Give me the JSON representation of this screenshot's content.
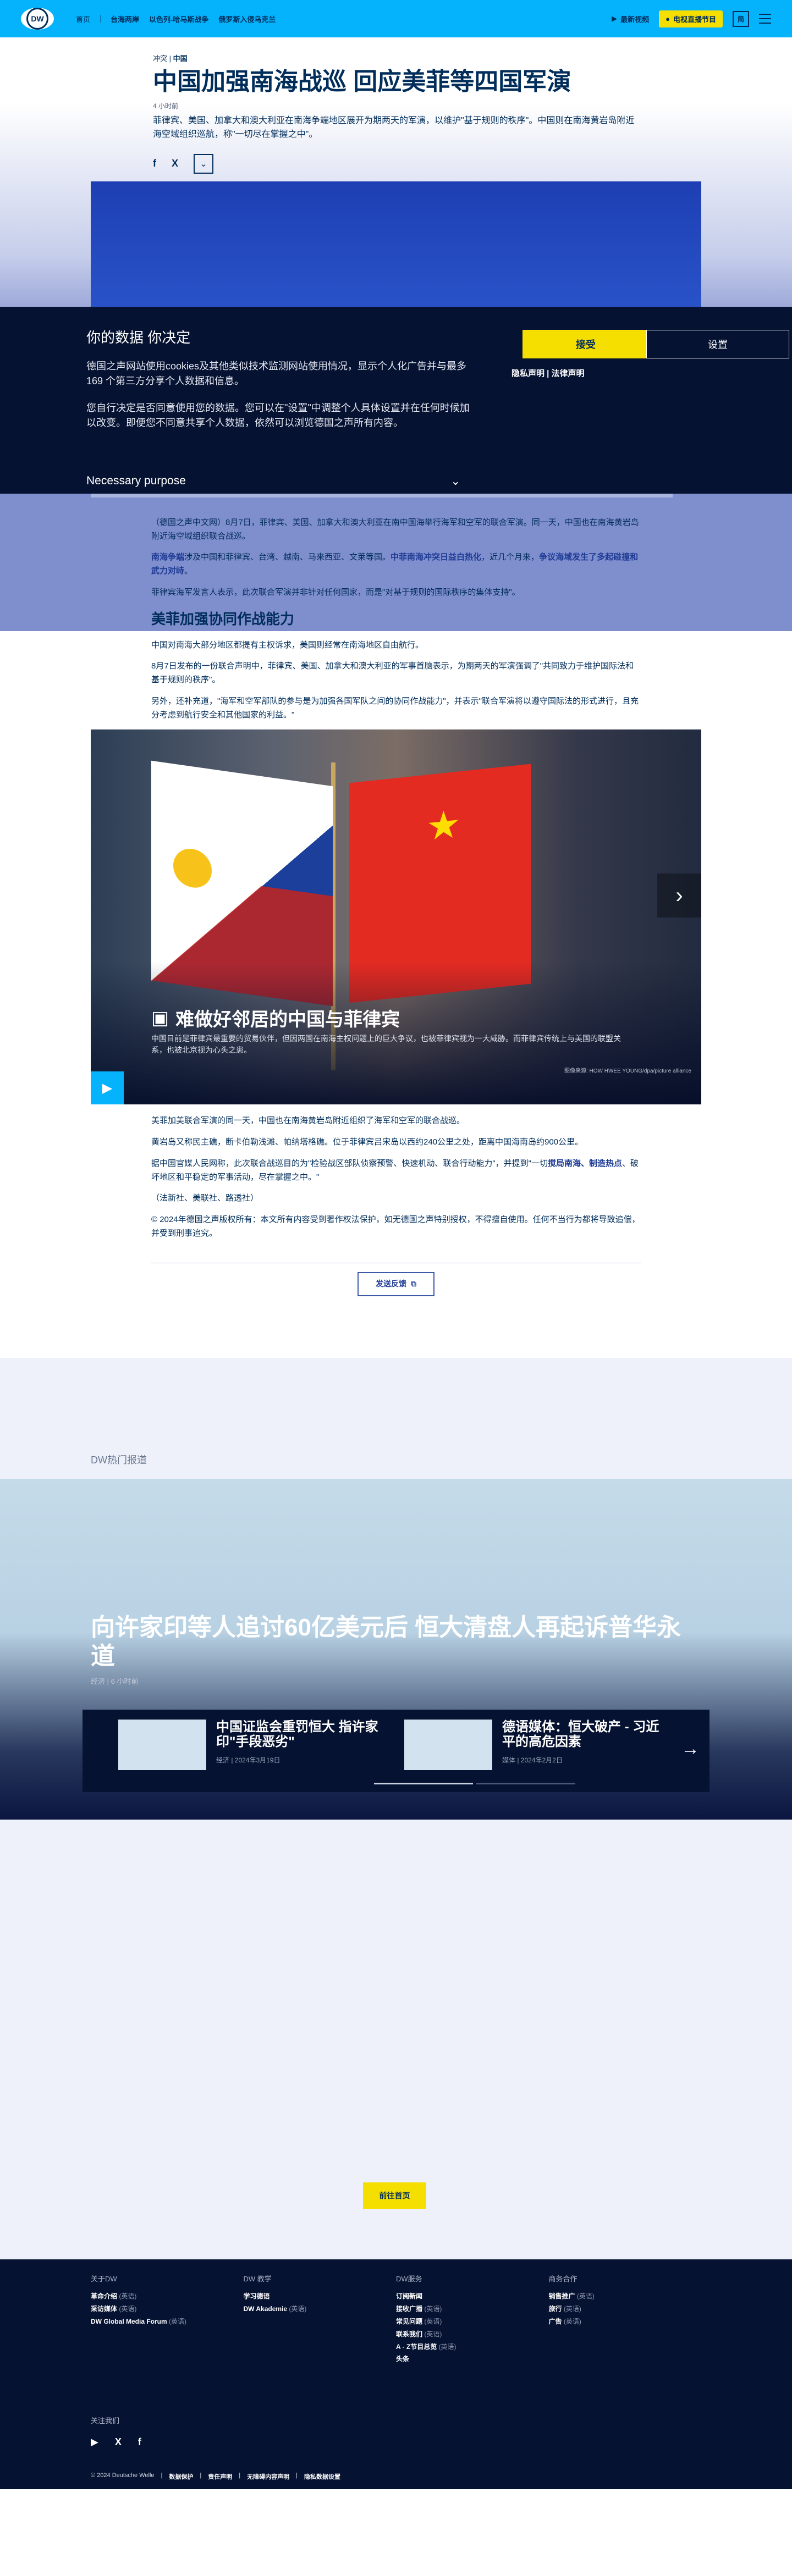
{
  "header": {
    "logo": "DW",
    "nav": [
      "首页",
      "台海两岸",
      "以色列-哈马斯战争",
      "俄罗斯入侵乌克兰"
    ],
    "video_label": "最新视频",
    "tv_label": "电视直播节目",
    "lang_label": "简"
  },
  "article": {
    "kicker_section": "冲突",
    "kicker_tag": "中国",
    "title": "中国加强南海战巡 回应美菲等四国军演",
    "time": "4 小时前",
    "teaser": "菲律宾、美国、加拿大和澳大利亚在南海争端地区展开为期两天的军演，以维护\"基于规则的秩序\"。中国则在南海黄岩岛附近海空域组织巡航，称\"一切尽在掌握之中\"。",
    "share": [
      "f",
      "X"
    ]
  },
  "cookie": {
    "title": "你的数据 你决定",
    "p1": "德国之声网站使用cookies及其他类似技术监测网站使用情况，显示个人化广告并与最多169 个第三方分享个人数据和信息。",
    "p2": "您自行决定是否同意使用您的数据。您可以在\"设置\"中调整个人具体设置并在任何时候加以改变。即便您不同意共享个人数据，依然可以浏览德国之声所有内容。",
    "purpose": "Necessary purpose",
    "accept": "接受",
    "settings": "设置",
    "links": "隐私声明 | 法律声明"
  },
  "body": {
    "p1": "（德国之声中文网）8月7日，菲律宾、美国、加拿大和澳大利亚在南中国海举行海军和空军的联合军演。同一天，中国也在南海黄岩岛附近海空域组织联合战巡。",
    "p2_link1": "南海争端",
    "p2_mid": "涉及中国和菲律宾、台湾、越南、马来西亚、文莱等国。",
    "p2_link2": "中菲南海冲突日益白热化",
    "p2_mid2": "，近几个月来，",
    "p2_link3": "争议海域发生了多起碰撞和武力对峙",
    "p2_end": "。",
    "p3": "菲律宾海军发言人表示，此次联合军演并非针对任何国家，而是\"对基于规则的国际秩序的集体支持\"。",
    "h2": "美菲加强协同作战能力",
    "p4": "中国对南海大部分地区都提有主权诉求，美国则经常在南海地区自由航行。",
    "p5": "8月7日发布的一份联合声明中，菲律宾、美国、加拿大和澳大利亚的军事首脑表示，为期两天的军演强调了\"共同致力于维护国际法和基于规则的秩序\"。",
    "p6": "另外，还补充道，\"海军和空军部队的参与是为加强各国军队之间的协同作战能力\"，并表示\"联合军演将以遵守国际法的形式进行，且充分考虑到航行安全和其他国家的利益。\"",
    "p7": "美菲加美联合军演的同一天，中国也在南海黄岩岛附近组织了海军和空军的联合战巡。",
    "p8": "黄岩岛又称民主礁，断卡伯勒浅滩、帕纳塔格礁。位于菲律宾吕宋岛以西约240公里之处，距离中国海南岛约900公里。",
    "p9_start": "据中国官媒人民网称，此次联合战巡目的为\"检验战区部队侦察预警、快速机动、联合行动能力\"，并提到\"一切",
    "p9_link": "搅局南海、制造热点",
    "p9_end": "、破坏地区和平稳定的军事活动，尽在掌握之中。\"",
    "p10": "（法新社、美联社、路透社）",
    "p11": "© 2024年德国之声版权所有：本文所有内容受到著作权法保护，如无德国之声特别授权，不得擅自使用。任何不当行为都将导致追偿，并受到刑事追究。",
    "feedback": "发送反馈"
  },
  "gallery": {
    "title": "难做好邻居的中国与菲律宾",
    "desc": "中国目前是菲律宾最重要的贸易伙伴，但因两国在南海主权问题上的巨大争议，也被菲律宾视为一大威胁。而菲律宾传统上与美国的联盟关系，也被北京视为心头之患。",
    "credit": "图像来源: HOW HWEE YOUNG/dpa/picture alliance"
  },
  "reco": {
    "label": "DW热门报道",
    "title": "向许家印等人追讨60亿美元后 恒大清盘人再起诉普华永道",
    "meta": "经济 | 6 小时前",
    "cards": [
      {
        "title": "中国证监会重罚恒大 指许家印\"手段恶劣\"",
        "meta": "经济 | 2024年3月19日"
      },
      {
        "title": "德语媒体：恒大破产 - 习近平的高危因素",
        "meta": "媒体 | 2024年2月2日"
      }
    ],
    "goto": "前往首页"
  },
  "footer": {
    "cols": [
      {
        "title": "关于DW",
        "items": [
          {
            "label": "革命介绍",
            "em": "(英语)"
          },
          {
            "label": "采访媒体",
            "em": "(英语)"
          },
          {
            "label": "DW Global Media Forum",
            "em": "(英语)"
          }
        ]
      },
      {
        "title": "DW 教学",
        "items": [
          {
            "label": "学习德语",
            "em": ""
          },
          {
            "label": "DW Akademie",
            "em": "(英语)"
          }
        ]
      },
      {
        "title": "DW服务",
        "items": [
          {
            "label": "订阅新闻",
            "em": ""
          },
          {
            "label": "接收广播",
            "em": "(英语)"
          },
          {
            "label": "常见问题",
            "em": "(英语)"
          },
          {
            "label": "联系我们",
            "em": "(英语)"
          },
          {
            "label": "A - Z节目总览",
            "em": "(英语)"
          },
          {
            "label": "头条",
            "em": ""
          }
        ]
      },
      {
        "title": "商务合作",
        "items": [
          {
            "label": "销售推广",
            "em": "(英语)"
          },
          {
            "label": "旅行",
            "em": "(英语)"
          },
          {
            "label": "广告",
            "em": "(英语)"
          }
        ]
      }
    ],
    "follow": "关注我们",
    "legal": [
      "© 2024 Deutsche Welle",
      "数据保护",
      "责任声明",
      "无障碍内容声明",
      "隐私数据设置"
    ]
  }
}
